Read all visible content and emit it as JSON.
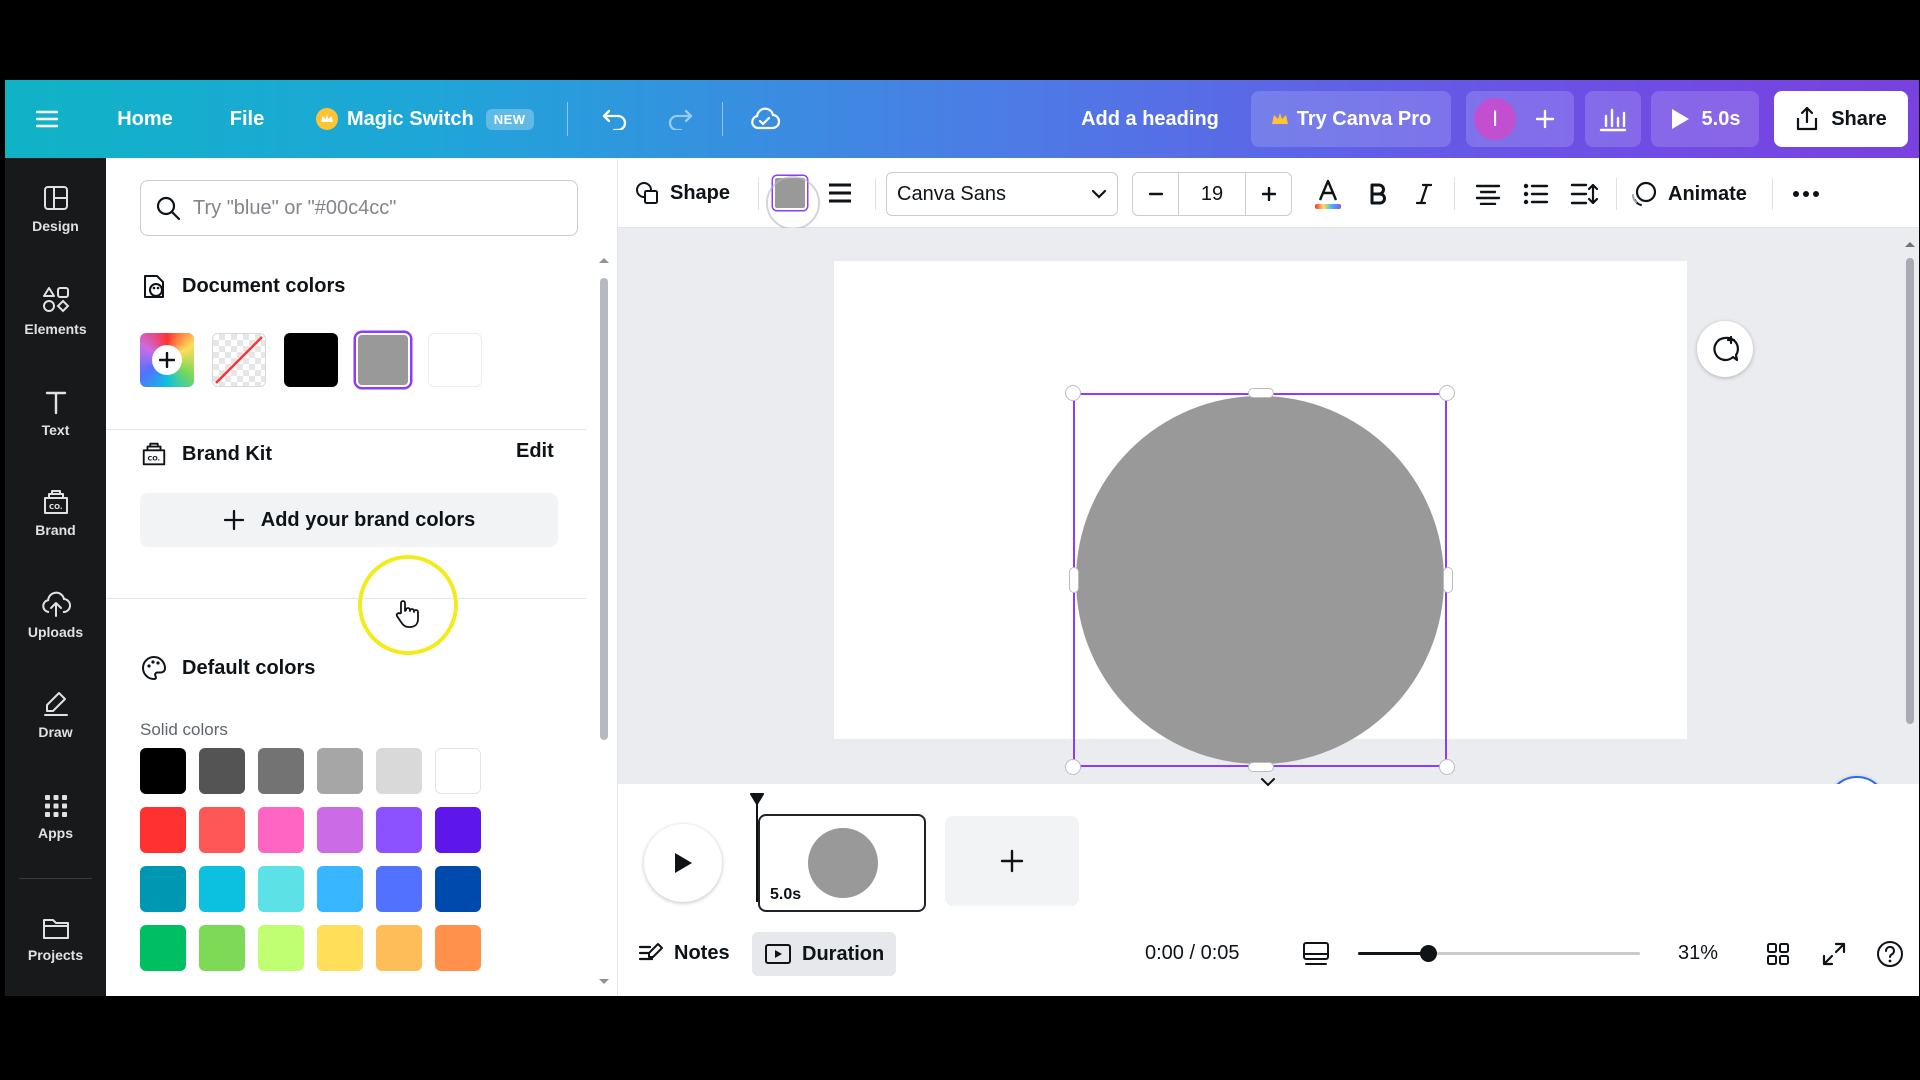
{
  "topbar": {
    "home": "Home",
    "file": "File",
    "magic_switch": "Magic Switch",
    "new_badge": "NEW",
    "heading": "Add a heading",
    "try_pro": "Try Canva Pro",
    "avatar_initial": "I",
    "duration": "5.0s",
    "share": "Share"
  },
  "rail": {
    "items": [
      {
        "label": "Design"
      },
      {
        "label": "Elements"
      },
      {
        "label": "Text"
      },
      {
        "label": "Brand"
      },
      {
        "label": "Uploads"
      },
      {
        "label": "Draw"
      },
      {
        "label": "Apps"
      },
      {
        "label": "Projects"
      }
    ]
  },
  "panel": {
    "search_placeholder": "Try \"blue\" or \"#00c4cc\"",
    "document_colors_title": "Document colors",
    "document_colors": [
      "#000000",
      "#999999",
      "#ffffff"
    ],
    "brand_kit_title": "Brand Kit",
    "brand_kit_edit": "Edit",
    "add_brand_colors": "Add your brand colors",
    "default_colors_title": "Default colors",
    "solid_colors_label": "Solid colors",
    "solid_colors": [
      [
        "#000000",
        "#545454",
        "#737373",
        "#a6a6a6",
        "#d9d9d9",
        "#ffffff"
      ],
      [
        "#ff3131",
        "#ff5757",
        "#ff66c4",
        "#cb6ce6",
        "#8c52ff",
        "#5e17eb"
      ],
      [
        "#0097b2",
        "#0cc0df",
        "#5ce1e6",
        "#38b6ff",
        "#5271ff",
        "#004aad"
      ],
      [
        "#00bf63",
        "#7ed957",
        "#c1ff72",
        "#ffde59",
        "#ffbd59",
        "#ff914d"
      ]
    ]
  },
  "toolbar": {
    "shape": "Shape",
    "font": "Canva Sans",
    "font_size": "19",
    "animate": "Animate"
  },
  "canvas": {
    "shape_color": "#999999",
    "accent": "#8b3dff"
  },
  "timeline": {
    "page_duration": "5.0s",
    "notes": "Notes",
    "duration": "Duration",
    "time": "0:00 / 0:05",
    "zoom": "31%"
  }
}
